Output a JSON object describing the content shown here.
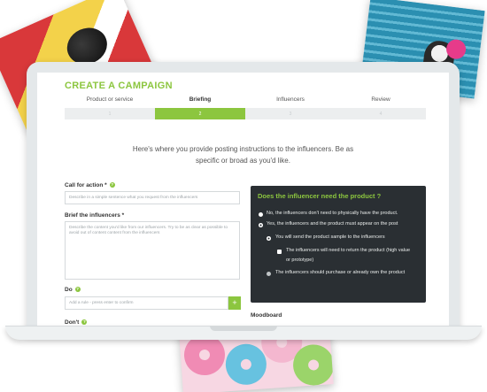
{
  "campaign": {
    "title": "CREATE A CAMPAIGN"
  },
  "steps": [
    {
      "label": "Product or service",
      "number": "1",
      "active": false
    },
    {
      "label": "Briefing",
      "number": "2",
      "active": true
    },
    {
      "label": "Influencers",
      "number": "3",
      "active": false
    },
    {
      "label": "Review",
      "number": "4",
      "active": false
    }
  ],
  "intro_text": "Here's where you provide posting instructions to the influencers. Be as specific or broad as you'd like.",
  "form": {
    "call_for_action": {
      "label": "Call for action *",
      "help": "?",
      "placeholder": "Describe in a simple sentence what you request from the influencers"
    },
    "brief": {
      "label": "Brief the influencers *",
      "placeholder": "Describe the content you'd like from our influencers. Try to be as clear as possible to avoid out of content content from the influencers"
    },
    "do": {
      "label": "Do",
      "help": "?",
      "placeholder": "Add a rule - press enter to confirm",
      "add_label": "+"
    },
    "dont": {
      "label": "Don't",
      "help": "?"
    }
  },
  "product_panel": {
    "title": "Does the influencer need the product ?",
    "options": [
      "No, the influencers don't need to physically have the product.",
      "Yes, the influencers and the product must appear on the post"
    ],
    "sub_options": [
      "You will send the product sample to the influencers",
      "The influencers should purchase or already own the product"
    ],
    "return_check_line1": "The influencers will need to return the product (high value",
    "return_check_line2": "or prototype)"
  },
  "moodboard_label": "Moodboard",
  "colors": {
    "accent": "#8cc63f",
    "panel": "#2a2f33"
  }
}
